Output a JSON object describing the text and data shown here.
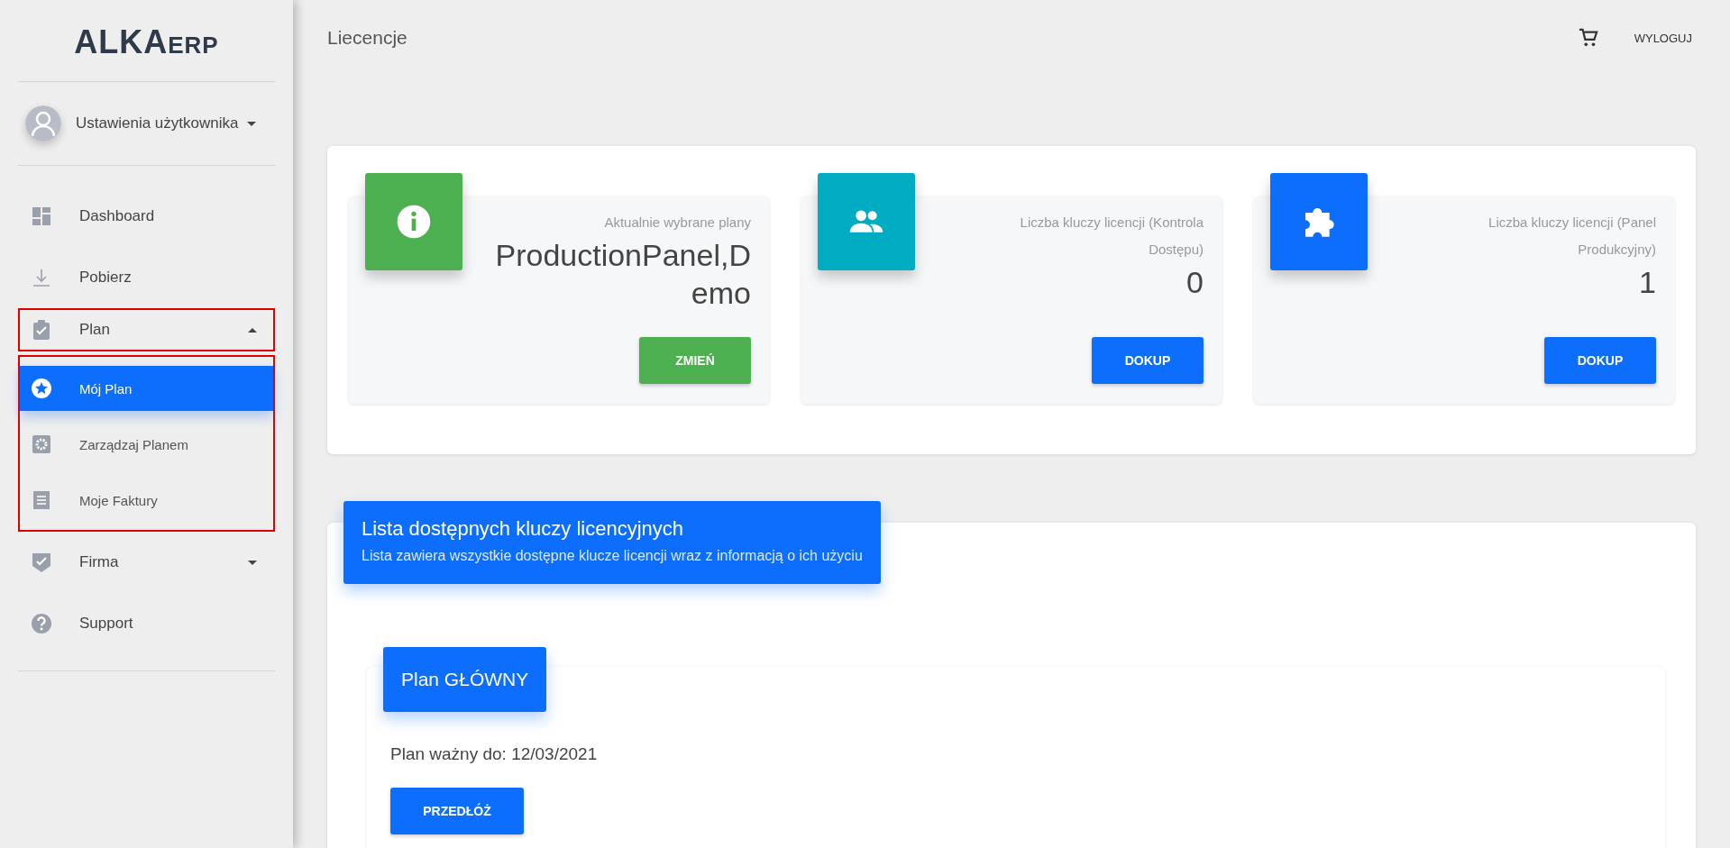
{
  "logo": {
    "main": "ALKA",
    "suffix": "ERP"
  },
  "user": {
    "label": "Ustawienia użytkownika"
  },
  "nav": [
    {
      "label": "Dashboard",
      "kind": "link"
    },
    {
      "label": "Pobierz",
      "kind": "link"
    },
    {
      "label": "Plan",
      "kind": "group",
      "expanded": true,
      "highlighted": true,
      "children": [
        {
          "label": "Mój Plan",
          "selected": true
        },
        {
          "label": "Zarządzaj Planem",
          "selected": false
        },
        {
          "label": "Moje Faktury",
          "selected": false
        }
      ]
    },
    {
      "label": "Firma",
      "kind": "group",
      "expanded": false,
      "highlighted": false
    },
    {
      "label": "Support",
      "kind": "link"
    }
  ],
  "header": {
    "title": "Liecencje",
    "logout": "WYLOGUJ"
  },
  "stats": [
    {
      "color": "#4caf50",
      "caption": "Aktualnie wybrane plany",
      "value": "ProductionPanel,Demo",
      "button": "ZMIEŃ",
      "kind": "success"
    },
    {
      "color": "#00acc1",
      "caption": "Liczba kluczy licencji (Kontrola Dostępu)",
      "value": "0",
      "button": "DOKUP",
      "kind": "primary"
    },
    {
      "color": "#0d6efd",
      "caption": "Liczba kluczy licencji (Panel Produkcyjny)",
      "value": "1",
      "button": "DOKUP",
      "kind": "primary"
    }
  ],
  "keys": {
    "title": "Lista dostępnych kluczy licencyjnych",
    "subtitle": "Lista zawiera wszystkie dostępne klucze licencji wraz z informacją o ich użyciu",
    "plan": {
      "title": "Plan GŁÓWNY",
      "valid": "Plan ważny do: 12/03/2021",
      "button": "PRZEDŁÓŻ"
    }
  }
}
